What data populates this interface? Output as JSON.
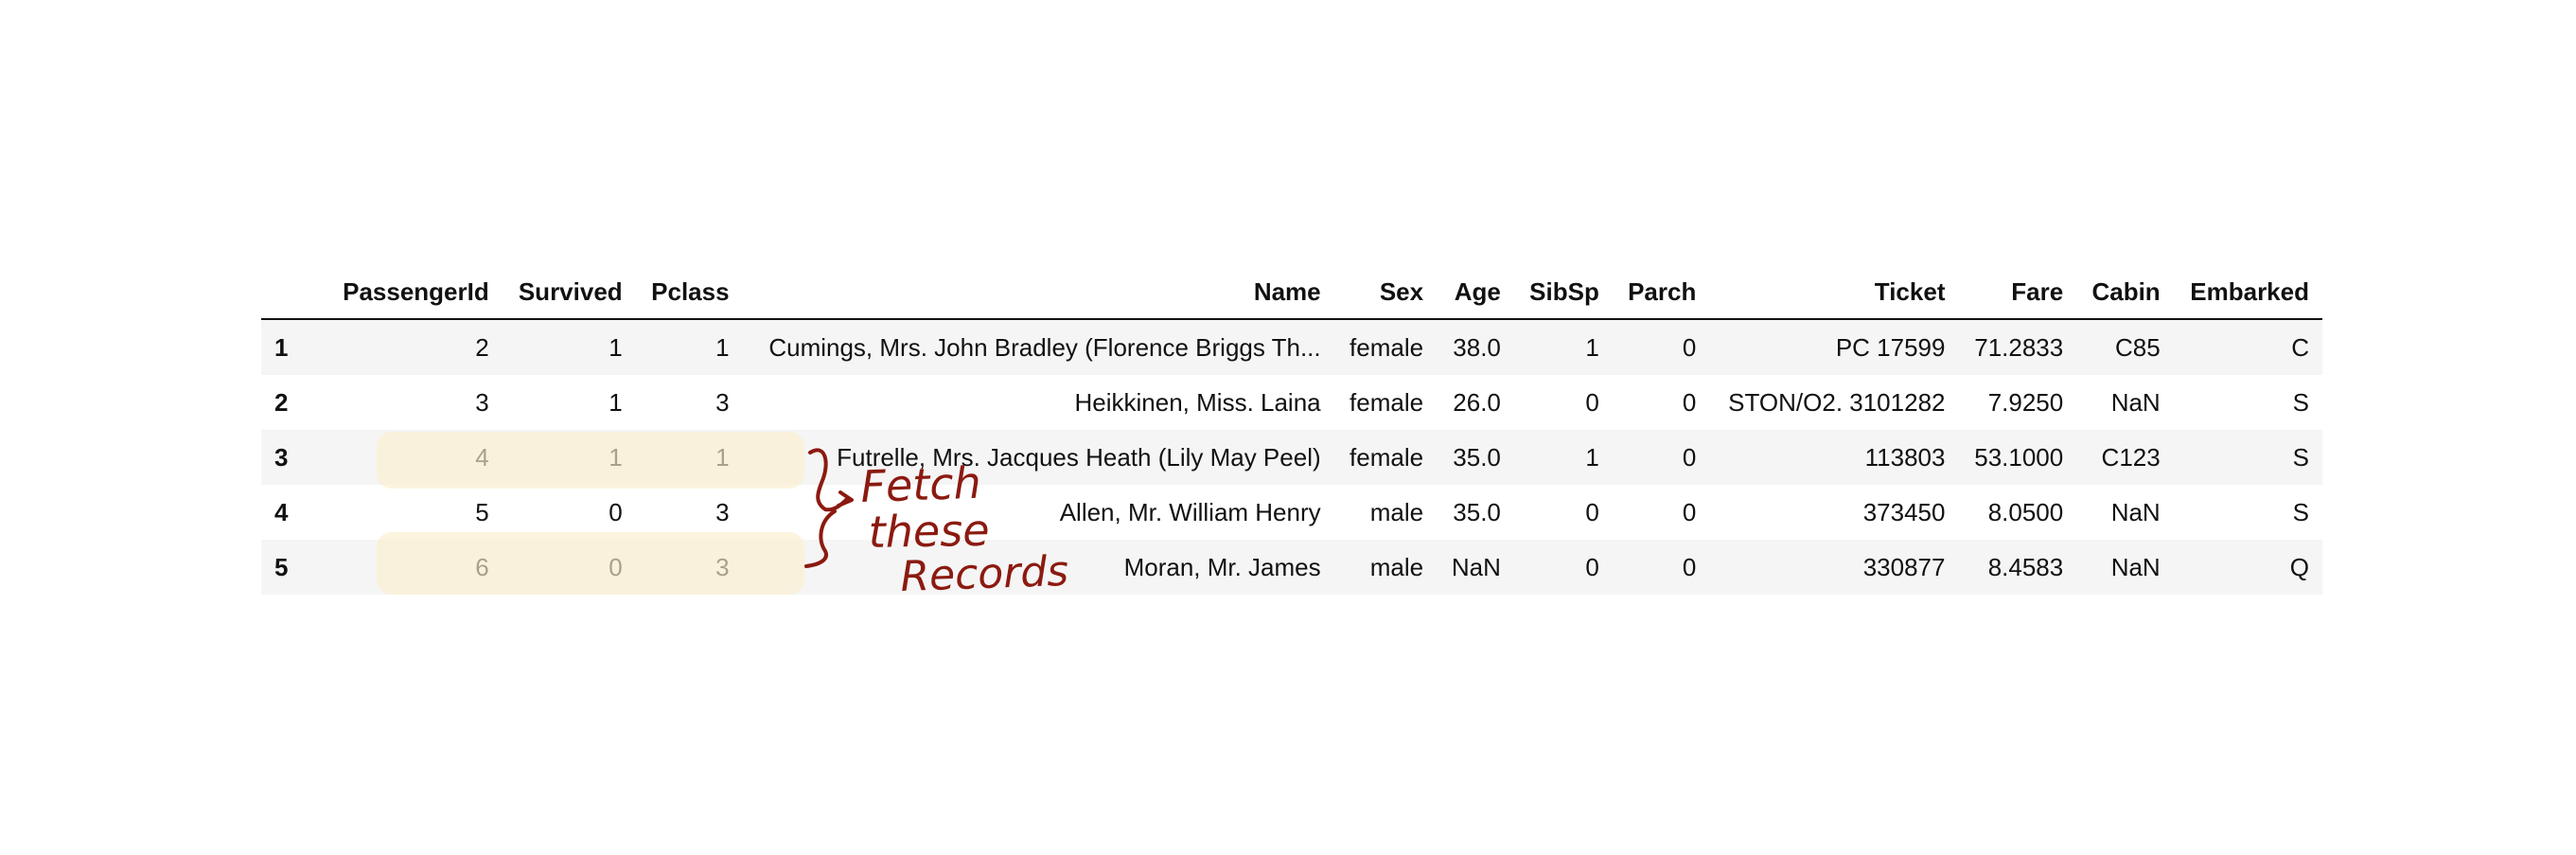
{
  "table": {
    "columns": [
      "",
      "PassengerId",
      "Survived",
      "Pclass",
      "Name",
      "Sex",
      "Age",
      "SibSp",
      "Parch",
      "Ticket",
      "Fare",
      "Cabin",
      "Embarked"
    ],
    "rows": [
      {
        "index": "1",
        "PassengerId": "2",
        "Survived": "1",
        "Pclass": "1",
        "Name": "Cumings, Mrs. John Bradley (Florence Briggs Th...",
        "Sex": "female",
        "Age": "38.0",
        "SibSp": "1",
        "Parch": "0",
        "Ticket": "PC 17599",
        "Fare": "71.2833",
        "Cabin": "C85",
        "Embarked": "C"
      },
      {
        "index": "2",
        "PassengerId": "3",
        "Survived": "1",
        "Pclass": "3",
        "Name": "Heikkinen, Miss. Laina",
        "Sex": "female",
        "Age": "26.0",
        "SibSp": "0",
        "Parch": "0",
        "Ticket": "STON/O2. 3101282",
        "Fare": "7.9250",
        "Cabin": "NaN",
        "Embarked": "S"
      },
      {
        "index": "3",
        "PassengerId": "4",
        "Survived": "1",
        "Pclass": "1",
        "Name": "Futrelle, Mrs. Jacques Heath (Lily May Peel)",
        "Sex": "female",
        "Age": "35.0",
        "SibSp": "1",
        "Parch": "0",
        "Ticket": "113803",
        "Fare": "53.1000",
        "Cabin": "C123",
        "Embarked": "S"
      },
      {
        "index": "4",
        "PassengerId": "5",
        "Survived": "0",
        "Pclass": "3",
        "Name": "Allen, Mr. William Henry",
        "Sex": "male",
        "Age": "35.0",
        "SibSp": "0",
        "Parch": "0",
        "Ticket": "373450",
        "Fare": "8.0500",
        "Cabin": "NaN",
        "Embarked": "S"
      },
      {
        "index": "5",
        "PassengerId": "6",
        "Survived": "0",
        "Pclass": "3",
        "Name": "Moran, Mr. James",
        "Sex": "male",
        "Age": "NaN",
        "SibSp": "0",
        "Parch": "0",
        "Ticket": "330877",
        "Fare": "8.4583",
        "Cabin": "NaN",
        "Embarked": "Q"
      }
    ]
  },
  "annotation": {
    "lines": [
      "Fetch",
      "these",
      "Records"
    ],
    "ink_color": "#8b1a10",
    "highlight_color": "#faeecd"
  }
}
